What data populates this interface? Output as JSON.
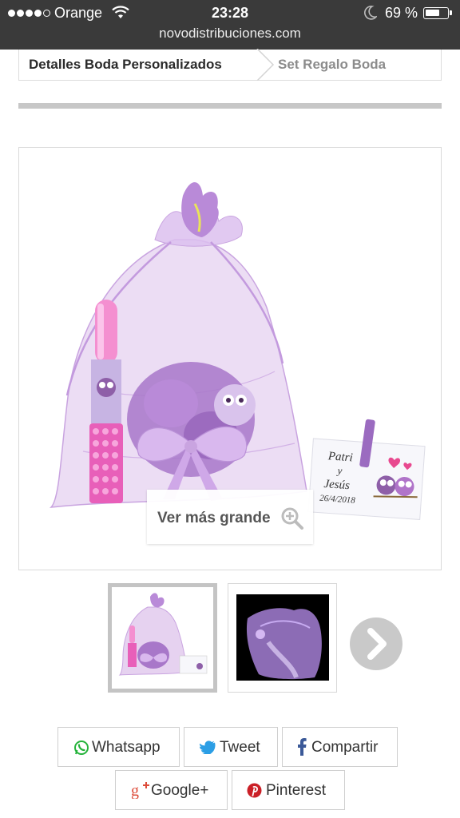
{
  "status_bar": {
    "carrier": "Orange",
    "time": "23:28",
    "battery": "69 %",
    "battery_level": 0.69,
    "url": "novodistribuciones.com"
  },
  "breadcrumb": {
    "item1": "Detalles Boda Personalizados",
    "item2": "Set Regalo Boda"
  },
  "main_image": {
    "card_name": "Patri",
    "card_and": "y",
    "card_name2": "Jesús",
    "card_date": "26/4/2018",
    "zoom_label": "Ver más grande"
  },
  "share": {
    "whatsapp": "Whatsapp",
    "tweet": "Tweet",
    "compartir": "Compartir",
    "google": "Google+",
    "pinterest": "Pinterest"
  },
  "colors": {
    "whatsapp": "#25b33b",
    "twitter": "#2b9ee5",
    "facebook": "#3b5998",
    "google": "#dd4b39",
    "pinterest": "#cb2027",
    "lavender": "#c9a4e0"
  }
}
